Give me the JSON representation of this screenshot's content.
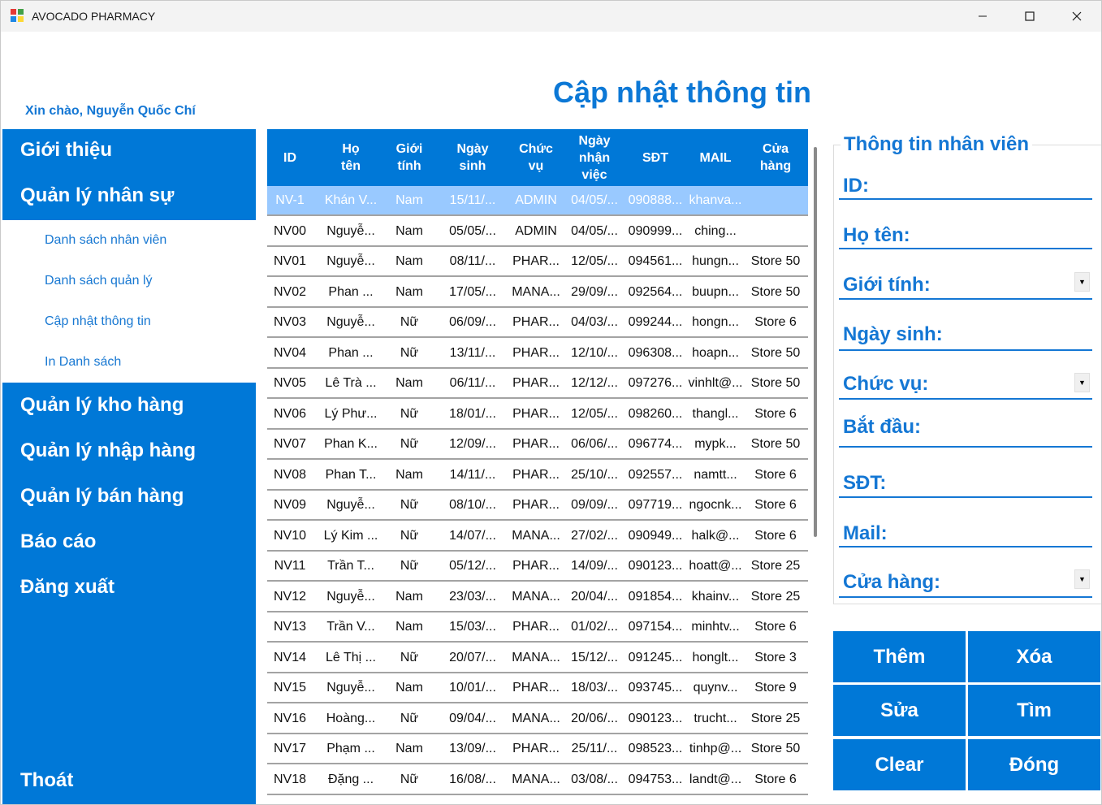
{
  "window": {
    "title": "AVOCADO PHARMACY"
  },
  "greeting": "Xin chào, Nguyễn Quốc Chí",
  "page_title": "Cập nhật thông tin",
  "sidebar": {
    "main_top": [
      "Giới thiệu",
      "Quản lý nhân sự"
    ],
    "sub_items": [
      "Danh sách nhân viên",
      "Danh sách quản lý",
      "Cập nhật thông tin",
      "In Danh sách"
    ],
    "main_bottom": [
      "Quản lý kho hàng",
      "Quản lý nhập hàng",
      "Quản lý bán hàng",
      "Báo cáo",
      "Đăng xuất"
    ],
    "exit": "Thoát"
  },
  "grid": {
    "headers": [
      [
        "ID"
      ],
      [
        "Họ",
        "tên"
      ],
      [
        "Giới",
        "tính"
      ],
      [
        "Ngày",
        "sinh"
      ],
      [
        "Chức",
        "vụ"
      ],
      [
        "Ngày",
        "nhận",
        "việc"
      ],
      [
        "SĐT"
      ],
      [
        "MAIL"
      ],
      [
        "Cửa",
        "hàng"
      ]
    ],
    "selected_row": 0,
    "rows": [
      [
        "NV-1",
        "Khán V...",
        "Nam",
        "15/11/...",
        "ADMIN",
        "04/05/...",
        "090888...",
        "khanva...",
        ""
      ],
      [
        "NV00",
        "Nguyễ...",
        "Nam",
        "05/05/...",
        "ADMIN",
        "04/05/...",
        "090999...",
        "ching...",
        ""
      ],
      [
        "NV01",
        "Nguyễ...",
        "Nam",
        "08/11/...",
        "PHAR...",
        "12/05/...",
        "094561...",
        "hungn...",
        "Store 50"
      ],
      [
        "NV02",
        "Phan ...",
        "Nam",
        "17/05/...",
        "MANA...",
        "29/09/...",
        "092564...",
        "buupn...",
        "Store 50"
      ],
      [
        "NV03",
        "Nguyễ...",
        "Nữ",
        "06/09/...",
        "PHAR...",
        "04/03/...",
        "099244...",
        "hongn...",
        "Store 6"
      ],
      [
        "NV04",
        "Phan ...",
        "Nữ",
        "13/11/...",
        "PHAR...",
        "12/10/...",
        "096308...",
        "hoapn...",
        "Store 50"
      ],
      [
        "NV05",
        "Lê Trà ...",
        "Nam",
        "06/11/...",
        "PHAR...",
        "12/12/...",
        "097276...",
        "vinhlt@...",
        "Store 50"
      ],
      [
        "NV06",
        "Lý Phư...",
        "Nữ",
        "18/01/...",
        "PHAR...",
        "12/05/...",
        "098260...",
        "thangl...",
        "Store 6"
      ],
      [
        "NV07",
        "Phan K...",
        "Nữ",
        "12/09/...",
        "PHAR...",
        "06/06/...",
        "096774...",
        "mypk...",
        "Store 50"
      ],
      [
        "NV08",
        "Phan T...",
        "Nam",
        "14/11/...",
        "PHAR...",
        "25/10/...",
        "092557...",
        "namtt...",
        "Store 6"
      ],
      [
        "NV09",
        "Nguyễ...",
        "Nữ",
        "08/10/...",
        "PHAR...",
        "09/09/...",
        "097719...",
        "ngocnk...",
        "Store 6"
      ],
      [
        "NV10",
        "Lý Kim ...",
        "Nữ",
        "14/07/...",
        "MANA...",
        "27/02/...",
        "090949...",
        "halk@...",
        "Store 6"
      ],
      [
        "NV11",
        "Trần T...",
        "Nữ",
        "05/12/...",
        "PHAR...",
        "14/09/...",
        "090123...",
        "hoatt@...",
        "Store 25"
      ],
      [
        "NV12",
        "Nguyễ...",
        "Nam",
        "23/03/...",
        "MANA...",
        "20/04/...",
        "091854...",
        "khainv...",
        "Store 25"
      ],
      [
        "NV13",
        "Trần V...",
        "Nam",
        "15/03/...",
        "PHAR...",
        "01/02/...",
        "097154...",
        "minhtv...",
        "Store 6"
      ],
      [
        "NV14",
        "Lê Thị ...",
        "Nữ",
        "20/07/...",
        "MANA...",
        "15/12/...",
        "091245...",
        "honglt...",
        "Store 3"
      ],
      [
        "NV15",
        "Nguyễ...",
        "Nam",
        "10/01/...",
        "PHAR...",
        "18/03/...",
        "093745...",
        "quynv...",
        "Store 9"
      ],
      [
        "NV16",
        "Hoàng...",
        "Nữ",
        "09/04/...",
        "MANA...",
        "20/06/...",
        "090123...",
        "trucht...",
        "Store 25"
      ],
      [
        "NV17",
        "Phạm ...",
        "Nam",
        "13/09/...",
        "PHAR...",
        "25/11/...",
        "098523...",
        "tinhp@...",
        "Store 50"
      ],
      [
        "NV18",
        "Đặng ...",
        "Nữ",
        "16/08/...",
        "MANA...",
        "03/08/...",
        "094753...",
        "landt@...",
        "Store 6"
      ]
    ]
  },
  "info_panel": {
    "title": "Thông tin nhân viên",
    "fields": [
      "ID:",
      "Họ tên:",
      "Giới tính:",
      "Ngày sinh:",
      "Chức vụ:",
      "Bắt đầu:",
      "SĐT:",
      "Mail:",
      "Cửa hàng:"
    ]
  },
  "actions": {
    "add": "Thêm",
    "delete": "Xóa",
    "edit": "Sửa",
    "find": "Tìm",
    "clear": "Clear",
    "close": "Đóng"
  },
  "colors": {
    "primary": "#0078d7",
    "accent_text": "#1477d4",
    "selected_row": "#99c9ff"
  }
}
